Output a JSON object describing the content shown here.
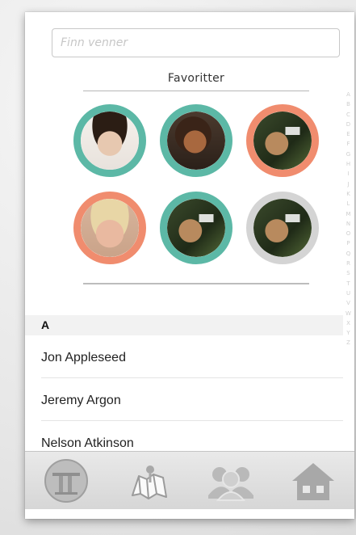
{
  "search": {
    "placeholder": "Finn venner"
  },
  "favorites": {
    "title": "Favoritter",
    "items": [
      {
        "ring": "teal",
        "ring_color": "#5cb8a6"
      },
      {
        "ring": "teal",
        "ring_color": "#5cb8a6"
      },
      {
        "ring": "salmon",
        "ring_color": "#f08c6e"
      },
      {
        "ring": "salmon",
        "ring_color": "#f08c6e"
      },
      {
        "ring": "teal",
        "ring_color": "#5cb8a6"
      },
      {
        "ring": "grey",
        "ring_color": "#d4d4d4"
      }
    ]
  },
  "index_letters": [
    "A",
    "B",
    "C",
    "D",
    "E",
    "F",
    "G",
    "H",
    "I",
    "J",
    "K",
    "L",
    "M",
    "N",
    "O",
    "P",
    "Q",
    "R",
    "S",
    "T",
    "U",
    "V",
    "W",
    "X",
    "Y",
    "Z"
  ],
  "contacts": {
    "section": "A",
    "rows": [
      {
        "first": "Jon",
        "last": "Appleseed"
      },
      {
        "first": "Jeremy",
        "last": "Argon"
      },
      {
        "first": "Nelson",
        "last": "Atkinson"
      }
    ]
  },
  "tabbar": {
    "tabs": [
      {
        "icon": "pillars-icon",
        "active": true
      },
      {
        "icon": "map-icon",
        "active": false
      },
      {
        "icon": "people-icon",
        "active": false
      },
      {
        "icon": "house-icon",
        "active": false
      }
    ]
  }
}
